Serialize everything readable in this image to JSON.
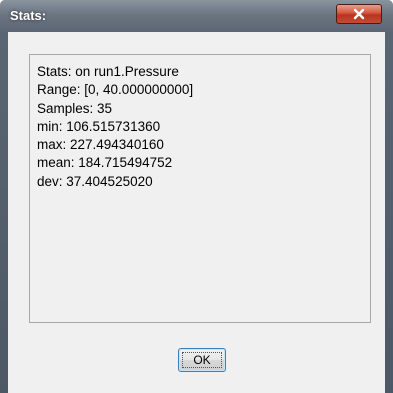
{
  "window": {
    "title": "Stats:"
  },
  "stats": {
    "lines": [
      "Stats: on run1.Pressure",
      "Range: [0, 40.000000000]",
      "Samples: 35",
      "min: 106.515731360",
      "max: 227.494340160",
      "mean: 184.715494752",
      "dev: 37.404525020"
    ]
  },
  "buttons": {
    "ok_label": "OK",
    "close_icon": "close-x-icon"
  },
  "colors": {
    "close_button": "#c74a32",
    "titlebar": "#6c7683",
    "client_bg": "#f0f0f0"
  }
}
